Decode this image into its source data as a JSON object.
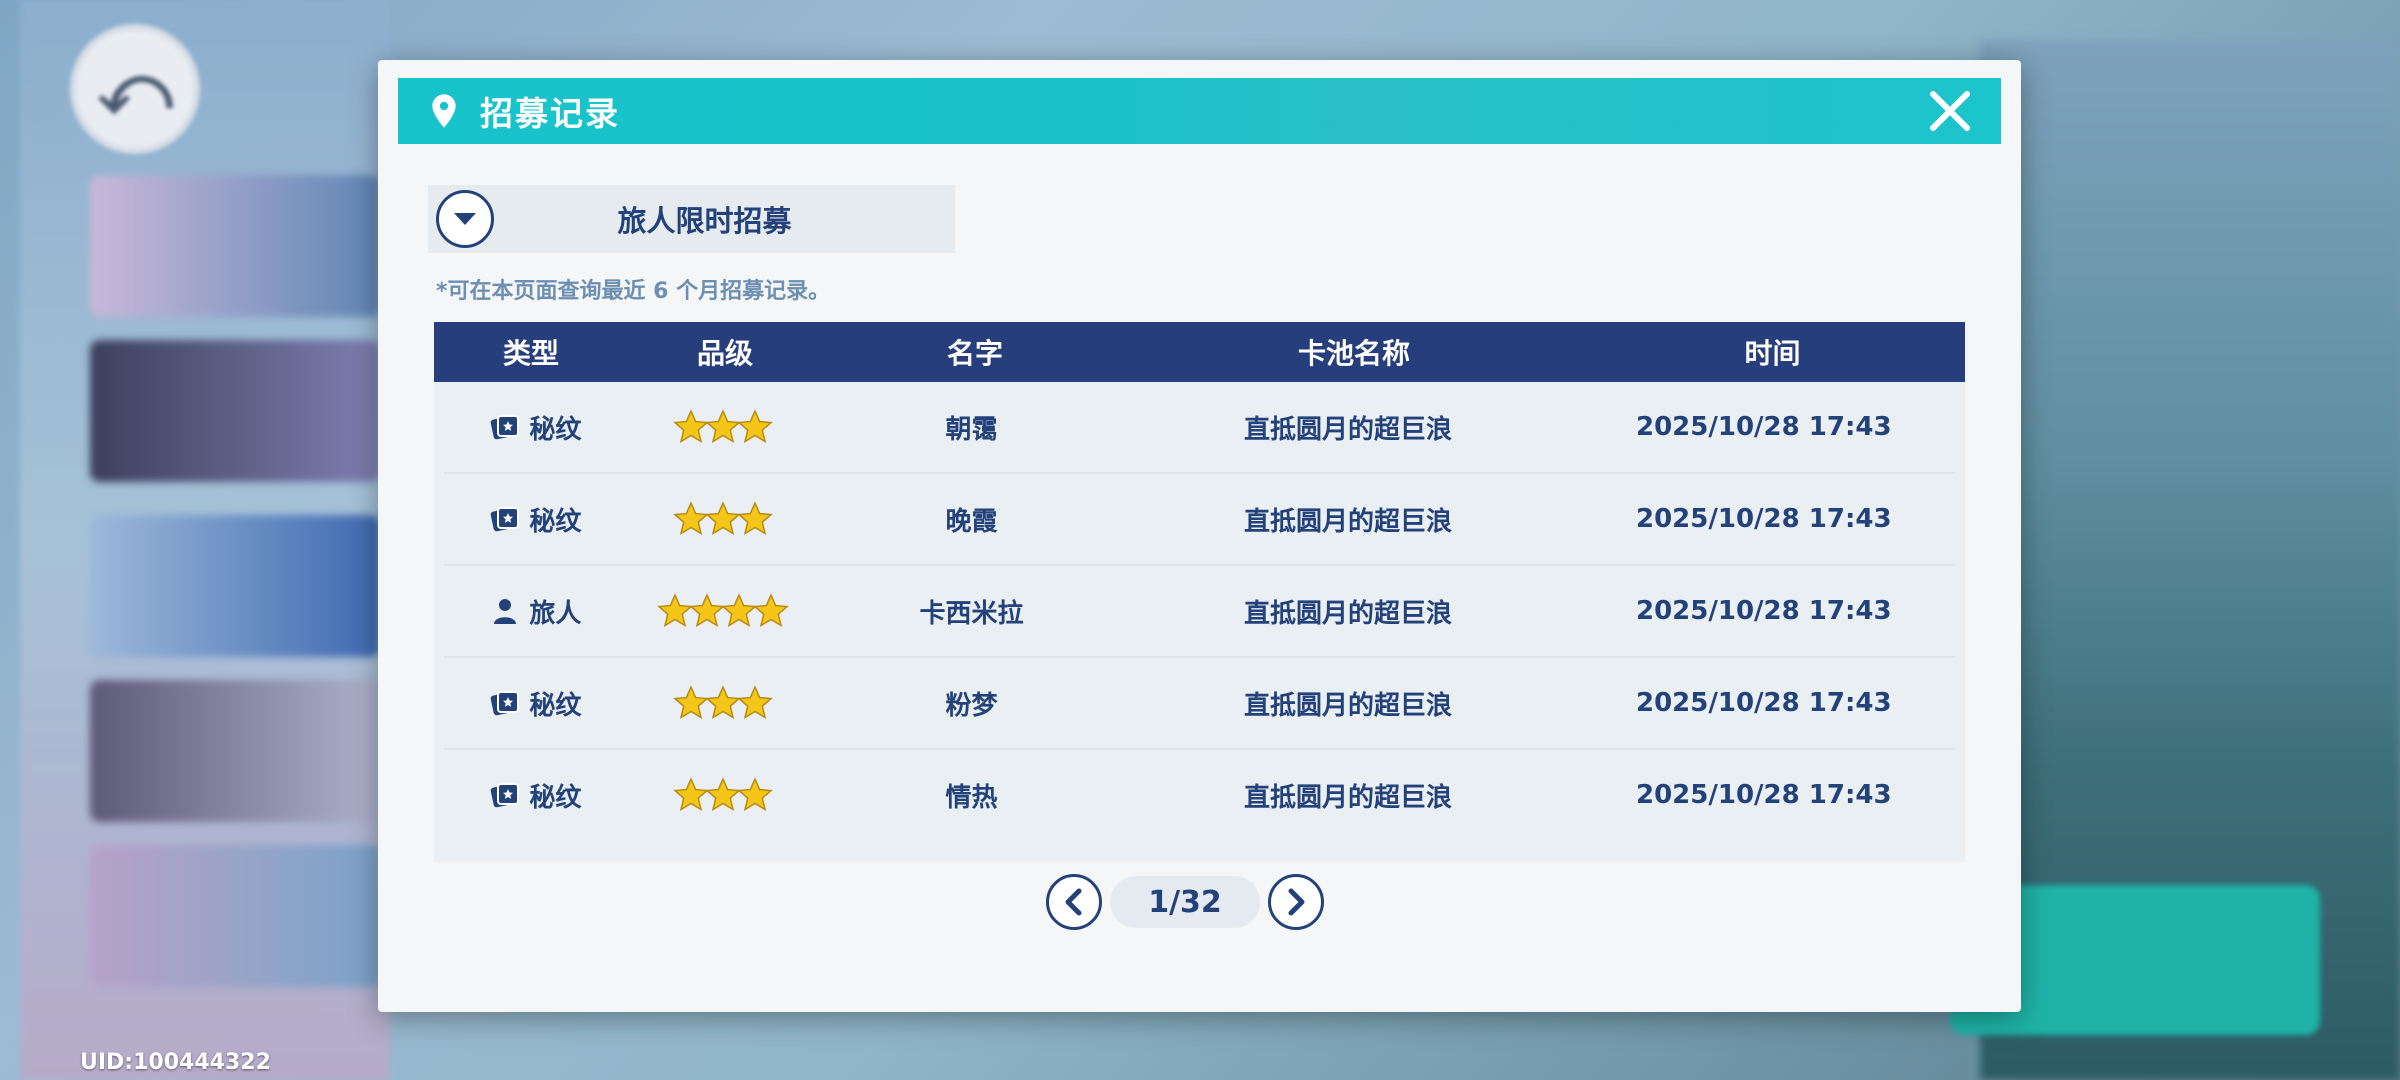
{
  "modal": {
    "title": "招募记录"
  },
  "pool_selector": {
    "selected": "旅人限时招募"
  },
  "note": "*可在本页面查询最近 6 个月招募记录。",
  "table": {
    "headers": [
      "类型",
      "品级",
      "名字",
      "卡池名称",
      "时间"
    ],
    "rows": [
      {
        "type": "秘纹",
        "type_icon": "card-icon",
        "stars": 3,
        "name": "朝霭",
        "pool": "直抵圆月的超巨浪",
        "time": "2025/10/28 17:43"
      },
      {
        "type": "秘纹",
        "type_icon": "card-icon",
        "stars": 3,
        "name": "晚霞",
        "pool": "直抵圆月的超巨浪",
        "time": "2025/10/28 17:43"
      },
      {
        "type": "旅人",
        "type_icon": "person-icon",
        "stars": 4,
        "name": "卡西米拉",
        "pool": "直抵圆月的超巨浪",
        "time": "2025/10/28 17:43"
      },
      {
        "type": "秘纹",
        "type_icon": "card-icon",
        "stars": 3,
        "name": "粉梦",
        "pool": "直抵圆月的超巨浪",
        "time": "2025/10/28 17:43"
      },
      {
        "type": "秘纹",
        "type_icon": "card-icon",
        "stars": 3,
        "name": "情热",
        "pool": "直抵圆月的超巨浪",
        "time": "2025/10/28 17:43"
      }
    ]
  },
  "pagination": {
    "label": "1/32"
  },
  "footer": {
    "uid": "UID:100444322"
  },
  "colors": {
    "header_teal": "#17c3cb",
    "navy": "#24427a",
    "table_header": "#263f7c",
    "star_gold": "#f5c518"
  }
}
